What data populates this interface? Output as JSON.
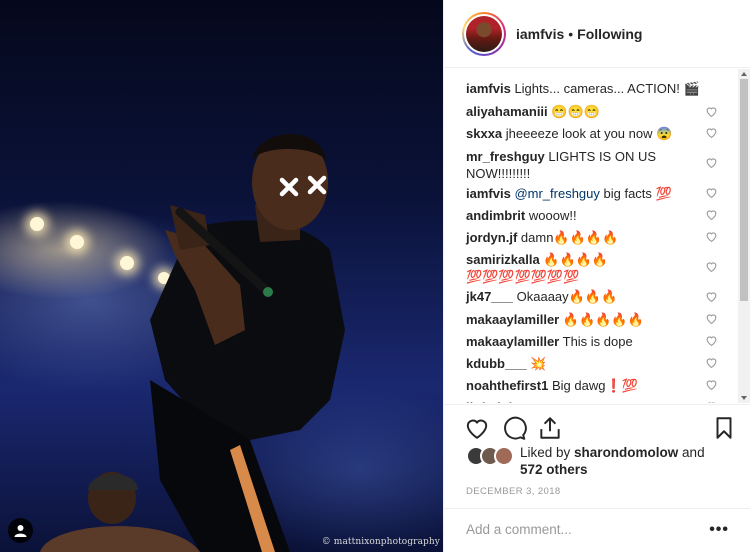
{
  "post": {
    "photo_credit": "© mattnixonphotography"
  },
  "header": {
    "username": "iamfvis",
    "separator": "•",
    "follow_status": "Following"
  },
  "comments": [
    {
      "user": "iamfvis",
      "text": "Lights... cameras... ACTION! 🎬",
      "liked_icon": false
    },
    {
      "user": "aliyahamaniii",
      "text": "😁😁😁",
      "liked_icon": true
    },
    {
      "user": "skxxa",
      "text": "jheeeeze look at you now 😨",
      "liked_icon": true
    },
    {
      "user": "mr_freshguy",
      "text": "LIGHTS IS ON US NOW!!!!!!!!!",
      "liked_icon": true
    },
    {
      "user": "iamfvis",
      "mention": "@mr_freshguy",
      "text": " big facts 💯",
      "liked_icon": true
    },
    {
      "user": "andimbrit",
      "text": "wooow!!",
      "liked_icon": true
    },
    {
      "user": "jordyn.jf",
      "text": "damn🔥🔥🔥🔥",
      "liked_icon": true
    },
    {
      "user": "samirizkalla",
      "text": "🔥🔥🔥🔥 💯💯💯💯💯💯💯",
      "liked_icon": true
    },
    {
      "user": "jk47___",
      "text": "Okaaaay🔥🔥🔥",
      "liked_icon": true
    },
    {
      "user": "makaaylamiller",
      "text": "🔥🔥🔥🔥🔥",
      "liked_icon": true
    },
    {
      "user": "makaaylamiller",
      "text": "This is dope",
      "liked_icon": true
    },
    {
      "user": "kdubb___",
      "text": "💥",
      "liked_icon": true
    },
    {
      "user": "noahthefirst1",
      "text": "Big dawg❗💯",
      "liked_icon": true
    },
    {
      "user": "littledole",
      "text": "Y",
      "liked_icon": true
    }
  ],
  "actions": {
    "like_icon": "heart-outline-icon",
    "comment_icon": "comment-bubble-icon",
    "share_icon": "share-upload-icon",
    "save_icon": "bookmark-icon"
  },
  "likes": {
    "prefix": "Liked by ",
    "user": "sharondomolow",
    "connector": " and",
    "others": "572 others"
  },
  "date": "DECEMBER 3, 2018",
  "add_comment": {
    "placeholder": "Add a comment...",
    "more": "•••"
  },
  "colors": {
    "text": "#262626",
    "muted": "#999999",
    "border": "#efefef",
    "link": "#003569"
  }
}
